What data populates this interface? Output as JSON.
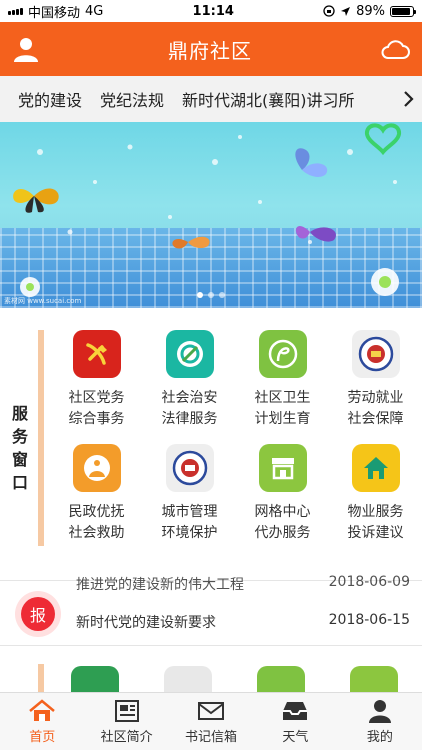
{
  "status_bar": {
    "carrier": "中国移动",
    "network": "4G",
    "time": "11:14",
    "battery": "89%"
  },
  "header": {
    "title": "鼎府社区",
    "left_icon": "user-icon",
    "right_icon": "cloud-icon",
    "color": "#f4611d"
  },
  "tabs": [
    "党的建设",
    "党纪法规",
    "新时代湖北(襄阳)讲习所"
  ],
  "banner": {
    "caption": "素材网 www.sucai.com"
  },
  "service": {
    "label": "服务窗口",
    "items": [
      {
        "line1": "社区党务",
        "line2": "综合事务",
        "icon": "party-emblem-icon"
      },
      {
        "line1": "社会治安",
        "line2": "法律服务",
        "icon": "social-order-icon"
      },
      {
        "line1": "社区卫生",
        "line2": "计划生育",
        "icon": "family-planning-icon"
      },
      {
        "line1": "劳动就业",
        "line2": "社会保障",
        "icon": "employment-seal-icon"
      },
      {
        "line1": "民政优抚",
        "line2": "社会救助",
        "icon": "civil-affairs-icon"
      },
      {
        "line1": "城市管理",
        "line2": "环境保护",
        "icon": "city-management-icon"
      },
      {
        "line1": "网格中心",
        "line2": "代办服务",
        "icon": "grid-center-store-icon"
      },
      {
        "line1": "物业服务",
        "line2": "投诉建议",
        "icon": "property-home-icon"
      }
    ]
  },
  "news": {
    "badge": "报",
    "items": [
      {
        "title": "推进党的建设新的伟大工程",
        "date": "2018-06-09"
      },
      {
        "title": "新时代党的建设新要求",
        "date": "2018-06-15"
      }
    ]
  },
  "nav": [
    {
      "label": "首页",
      "icon": "home-icon",
      "active": true
    },
    {
      "label": "社区简介",
      "icon": "newspaper-icon",
      "active": false
    },
    {
      "label": "书记信箱",
      "icon": "mail-icon",
      "active": false
    },
    {
      "label": "天气",
      "icon": "inbox-icon",
      "active": false
    },
    {
      "label": "我的",
      "icon": "person-icon",
      "active": false
    }
  ]
}
